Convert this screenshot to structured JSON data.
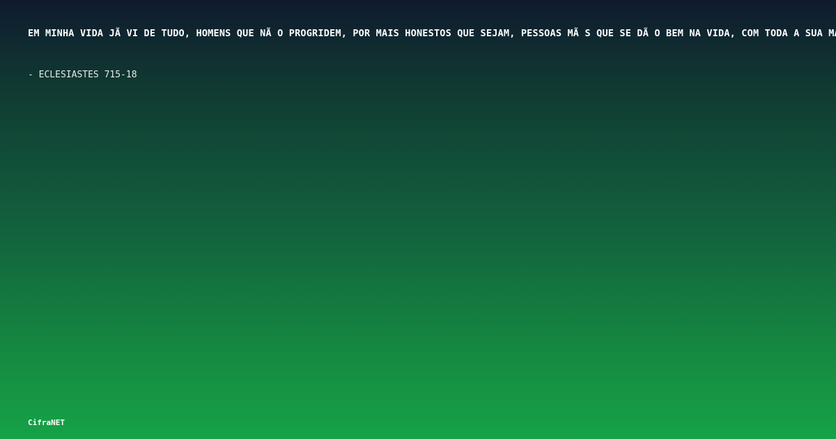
{
  "quote": {
    "text": "EM MINHA VIDA JÃ  VI DE TUDO, HOMENS QUE NÃ O PROGRIDEM, POR MAIS HONESTOS QUE SEJAM, PESSOAS MÃ S QUE SE DÃ O BEM NA VIDA, COM TODA A SUA MALDADE."
  },
  "reference": {
    "text": "- ECLESIASTES 715-18"
  },
  "brand": {
    "name": "CifraNET"
  },
  "colors": {
    "gradient_top": "#0f1a2e",
    "gradient_bottom": "#16a247",
    "text": "#ffffff"
  }
}
